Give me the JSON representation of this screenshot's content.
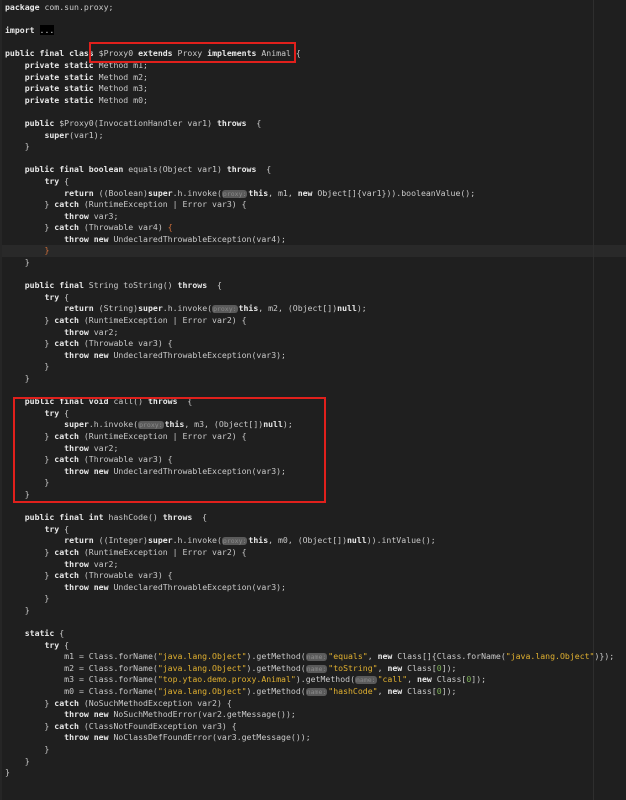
{
  "editor": {
    "highlights": {
      "box1": "class declaration",
      "box2": "call method"
    },
    "colors": {
      "background": "#1f1f1f",
      "string": "#e0b030",
      "highlight_box": "#e0201c"
    },
    "current_line": 22,
    "lines": [
      [
        [
          "k",
          "package"
        ],
        " com.sun.proxy;"
      ],
      [],
      [
        [
          "k",
          "import"
        ],
        " ",
        [
          "sel",
          "..."
        ]
      ],
      [],
      [
        [
          "k",
          "public final class"
        ],
        " $Proxy0 ",
        [
          "k",
          "extends"
        ],
        " Proxy ",
        [
          "k",
          "implements"
        ],
        " Animal {"
      ],
      [
        "    ",
        [
          "k",
          "private static"
        ],
        " Method m1;"
      ],
      [
        "    ",
        [
          "k",
          "private static"
        ],
        " Method m2;"
      ],
      [
        "    ",
        [
          "k",
          "private static"
        ],
        " Method m3;"
      ],
      [
        "    ",
        [
          "k",
          "private static"
        ],
        " Method m0;"
      ],
      [],
      [
        "    ",
        [
          "k",
          "public"
        ],
        " $Proxy0(InvocationHandler var1) ",
        [
          "k",
          "throws"
        ],
        "  {"
      ],
      [
        "        ",
        [
          "k",
          "super"
        ],
        "(var1);"
      ],
      [
        "    }"
      ],
      [],
      [
        "    ",
        [
          "k",
          "public final boolean"
        ],
        " equals(Object var1) ",
        [
          "k",
          "throws"
        ],
        "  {"
      ],
      [
        "        ",
        [
          "k",
          "try"
        ],
        " {"
      ],
      [
        "            ",
        [
          "k",
          "return"
        ],
        " ((Boolean)",
        [
          "k",
          "super"
        ],
        ".h.invoke(",
        [
          "h",
          "proxy:"
        ],
        [
          "k",
          "this"
        ],
        ", m1, ",
        [
          "k",
          "new"
        ],
        " Object[]{var1})).booleanValue();"
      ],
      [
        "        } ",
        [
          "k",
          "catch"
        ],
        " (RuntimeException | Error var3) {"
      ],
      [
        "            ",
        [
          "k",
          "throw"
        ],
        " var3;"
      ],
      [
        "        } ",
        [
          "k",
          "catch"
        ],
        " (Throwable var4) ",
        [
          "b",
          "{"
        ]
      ],
      [
        "            ",
        [
          "k",
          "throw new"
        ],
        " UndeclaredThrowableException(var4);"
      ],
      [
        "        ",
        [
          "b",
          "}"
        ]
      ],
      [
        "    }"
      ],
      [],
      [
        "    ",
        [
          "k",
          "public final"
        ],
        " String toString() ",
        [
          "k",
          "throws"
        ],
        "  {"
      ],
      [
        "        ",
        [
          "k",
          "try"
        ],
        " {"
      ],
      [
        "            ",
        [
          "k",
          "return"
        ],
        " (String)",
        [
          "k",
          "super"
        ],
        ".h.invoke(",
        [
          "h",
          "proxy:"
        ],
        [
          "k",
          "this"
        ],
        ", m2, (Object[])",
        [
          "k",
          "null"
        ],
        ");"
      ],
      [
        "        } ",
        [
          "k",
          "catch"
        ],
        " (RuntimeException | Error var2) {"
      ],
      [
        "            ",
        [
          "k",
          "throw"
        ],
        " var2;"
      ],
      [
        "        } ",
        [
          "k",
          "catch"
        ],
        " (Throwable var3) {"
      ],
      [
        "            ",
        [
          "k",
          "throw new"
        ],
        " UndeclaredThrowableException(var3);"
      ],
      [
        "        }"
      ],
      [
        "    }"
      ],
      [],
      [
        "    ",
        [
          "k",
          "public final void"
        ],
        " call() ",
        [
          "k",
          "throws"
        ],
        "  {"
      ],
      [
        "        ",
        [
          "k",
          "try"
        ],
        " {"
      ],
      [
        "            ",
        [
          "k",
          "super"
        ],
        ".h.invoke(",
        [
          "h",
          "proxy:"
        ],
        [
          "k",
          "this"
        ],
        ", m3, (Object[])",
        [
          "k",
          "null"
        ],
        ");"
      ],
      [
        "        } ",
        [
          "k",
          "catch"
        ],
        " (RuntimeException | Error var2) {"
      ],
      [
        "            ",
        [
          "k",
          "throw"
        ],
        " var2;"
      ],
      [
        "        } ",
        [
          "k",
          "catch"
        ],
        " (Throwable var3) {"
      ],
      [
        "            ",
        [
          "k",
          "throw new"
        ],
        " UndeclaredThrowableException(var3);"
      ],
      [
        "        }"
      ],
      [
        "    }"
      ],
      [],
      [
        "    ",
        [
          "k",
          "public final int"
        ],
        " hashCode() ",
        [
          "k",
          "throws"
        ],
        "  {"
      ],
      [
        "        ",
        [
          "k",
          "try"
        ],
        " {"
      ],
      [
        "            ",
        [
          "k",
          "return"
        ],
        " ((Integer)",
        [
          "k",
          "super"
        ],
        ".h.invoke(",
        [
          "h",
          "proxy:"
        ],
        [
          "k",
          "this"
        ],
        ", m0, (Object[])",
        [
          "k",
          "null"
        ],
        ")).intValue();"
      ],
      [
        "        } ",
        [
          "k",
          "catch"
        ],
        " (RuntimeException | Error var2) {"
      ],
      [
        "            ",
        [
          "k",
          "throw"
        ],
        " var2;"
      ],
      [
        "        } ",
        [
          "k",
          "catch"
        ],
        " (Throwable var3) {"
      ],
      [
        "            ",
        [
          "k",
          "throw new"
        ],
        " UndeclaredThrowableException(var3);"
      ],
      [
        "        }"
      ],
      [
        "    }"
      ],
      [],
      [
        "    ",
        [
          "k",
          "static"
        ],
        " {"
      ],
      [
        "        ",
        [
          "k",
          "try"
        ],
        " {"
      ],
      [
        "            m1 = Class.forName(",
        [
          "s",
          "\"java.lang.Object\""
        ],
        ").getMethod(",
        [
          "h",
          "name:"
        ],
        [
          "s",
          "\"equals\""
        ],
        ", ",
        [
          "k",
          "new"
        ],
        " Class[]{Class.forName(",
        [
          "s",
          "\"java.lang.Object\""
        ],
        ")});"
      ],
      [
        "            m2 = Class.forName(",
        [
          "s",
          "\"java.lang.Object\""
        ],
        ").getMethod(",
        [
          "h",
          "name:"
        ],
        [
          "s",
          "\"toString\""
        ],
        ", ",
        [
          "k",
          "new"
        ],
        " Class[",
        [
          "n",
          "0"
        ],
        "]);"
      ],
      [
        "            m3 = Class.forName(",
        [
          "s",
          "\"top.ytao.demo.proxy.Animal\""
        ],
        ").getMethod(",
        [
          "h",
          "name:"
        ],
        [
          "s",
          "\"call\""
        ],
        ", ",
        [
          "k",
          "new"
        ],
        " Class[",
        [
          "n",
          "0"
        ],
        "]);"
      ],
      [
        "            m0 = Class.forName(",
        [
          "s",
          "\"java.lang.Object\""
        ],
        ").getMethod(",
        [
          "h",
          "name:"
        ],
        [
          "s",
          "\"hashCode\""
        ],
        ", ",
        [
          "k",
          "new"
        ],
        " Class[",
        [
          "n",
          "0"
        ],
        "]);"
      ],
      [
        "        } ",
        [
          "k",
          "catch"
        ],
        " (NoSuchMethodException var2) {"
      ],
      [
        "            ",
        [
          "k",
          "throw new"
        ],
        " NoSuchMethodError(var2.getMessage());"
      ],
      [
        "        } ",
        [
          "k",
          "catch"
        ],
        " (ClassNotFoundException var3) {"
      ],
      [
        "            ",
        [
          "k",
          "throw new"
        ],
        " NoClassDefFoundError(var3.getMessage());"
      ],
      [
        "        }"
      ],
      [
        "    }"
      ],
      [
        "}"
      ]
    ]
  }
}
